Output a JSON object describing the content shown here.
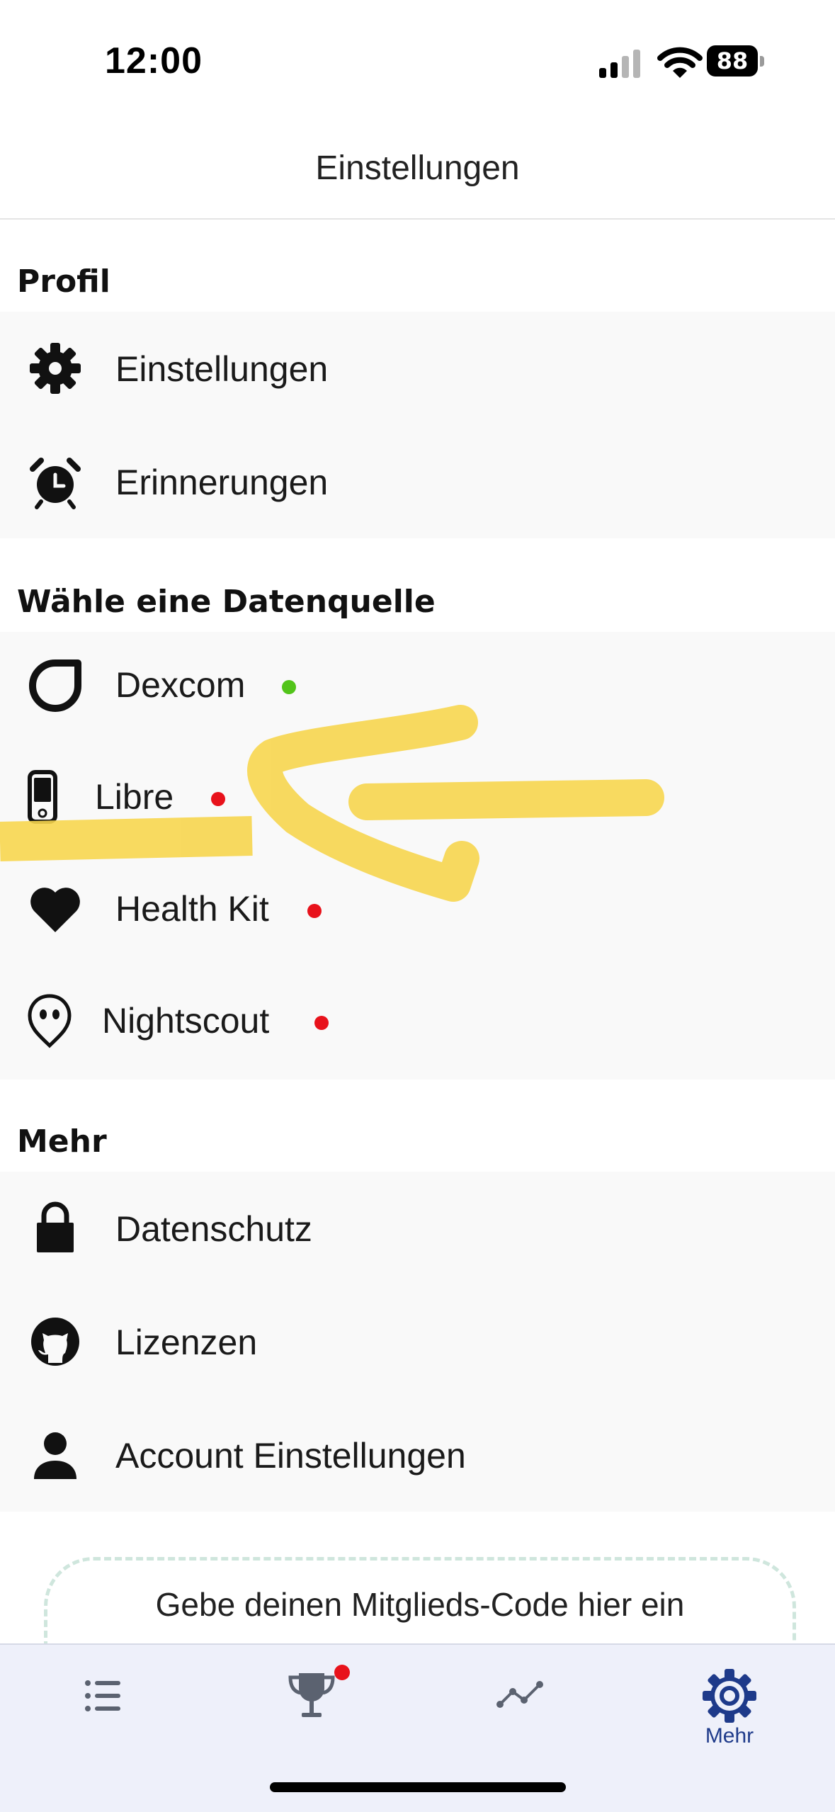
{
  "status_bar": {
    "time": "12:00",
    "battery": "88",
    "icons": [
      "cellular-signal-icon",
      "wifi-icon",
      "battery-icon"
    ]
  },
  "nav": {
    "title": "Einstellungen"
  },
  "sections": {
    "profile": {
      "title": "Profil",
      "items": [
        {
          "label": "Einstellungen",
          "icon": "gear-icon"
        },
        {
          "label": "Erinnerungen",
          "icon": "alarm-clock-icon"
        }
      ]
    },
    "datasource": {
      "title": "Wähle eine Datenquelle",
      "items": [
        {
          "label": "Dexcom",
          "icon": "dexcom-icon",
          "status": "connected"
        },
        {
          "label": "Libre",
          "icon": "libre-reader-icon",
          "status": "disconnected"
        },
        {
          "label": "Health Kit",
          "icon": "heart-icon",
          "status": "disconnected"
        },
        {
          "label": "Nightscout",
          "icon": "alien-pin-icon",
          "status": "disconnected"
        }
      ]
    },
    "more": {
      "title": "Mehr",
      "items": [
        {
          "label": "Datenschutz",
          "icon": "lock-icon"
        },
        {
          "label": "Lizenzen",
          "icon": "github-icon"
        },
        {
          "label": "Account Einstellungen",
          "icon": "person-icon"
        }
      ]
    }
  },
  "member_code": {
    "label": "Gebe deinen Mitglieds-Code hier ein"
  },
  "tabbar": {
    "items": [
      {
        "icon": "list-icon",
        "label": ""
      },
      {
        "icon": "trophy-icon",
        "label": "",
        "badge": true
      },
      {
        "icon": "chart-line-icon",
        "label": ""
      },
      {
        "icon": "gear-icon",
        "label": "Mehr",
        "active": true
      }
    ]
  },
  "colors": {
    "status_connected": "#52c41a",
    "status_disconnected": "#e8121b",
    "accent": "#1e3a8a",
    "highlight": "#f7d64f"
  }
}
